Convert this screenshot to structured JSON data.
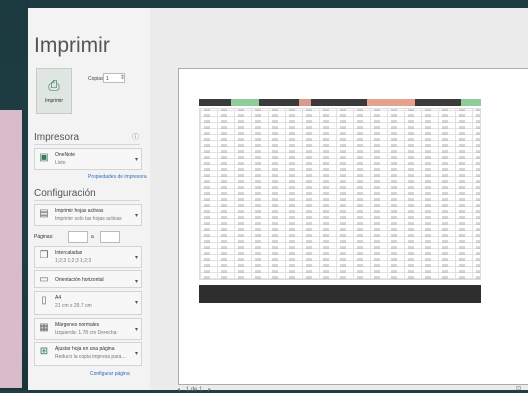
{
  "title": "Imprimir",
  "print_button": {
    "label": "Imprimir"
  },
  "copies": {
    "label": "Copias:",
    "value": "1"
  },
  "printer_section": {
    "heading": "Impresora",
    "printer_name": "OneNote",
    "printer_status": "Listo",
    "properties_link": "Propiedades de impresora"
  },
  "settings_section": {
    "heading": "Configuración",
    "active_sheets": {
      "line1": "Imprimir hojas activas",
      "line2": "Imprimir solo las hojas activas"
    },
    "pages": {
      "label": "Páginas:",
      "sep": "a"
    },
    "collated": {
      "line1": "Intercaladas",
      "line2": "1;2;3   1;2;3   1;2;3"
    },
    "orientation": {
      "line1": "Orientación horizontal"
    },
    "paper": {
      "line1": "A4",
      "line2": "21 cm x 29.7 cm"
    },
    "margins": {
      "line1": "Márgenes normales",
      "line2": "Izquierda: 1.78 cm   Derecha:"
    },
    "scaling": {
      "line1": "Ajustar hoja en una página",
      "line2": "Reducir la copia impresa para..."
    },
    "page_setup_link": "Configurar página"
  },
  "pager": {
    "prev": "◂",
    "current": "1",
    "of": "de 1",
    "next": "▸"
  }
}
